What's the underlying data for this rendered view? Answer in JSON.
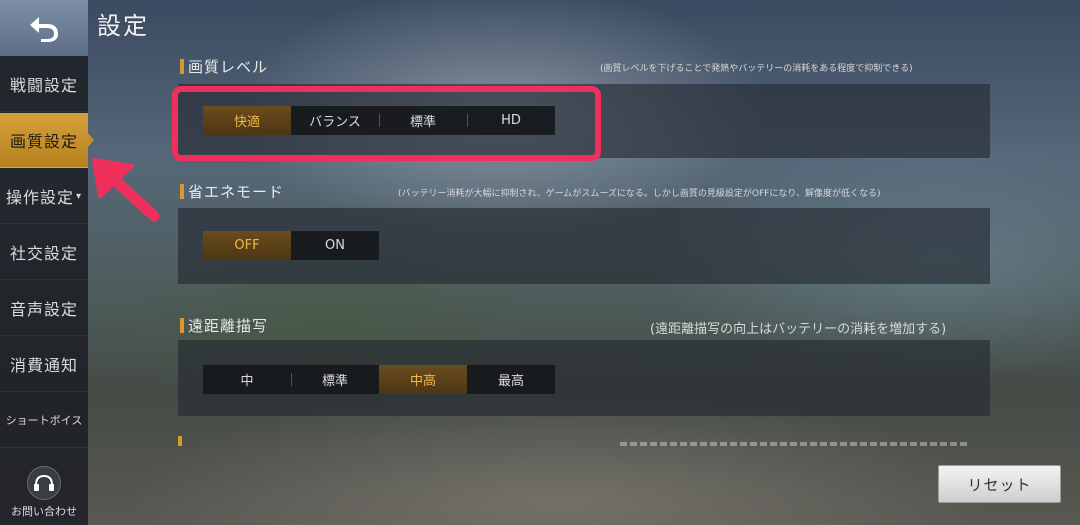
{
  "page_title": "設定",
  "sidebar": {
    "items": [
      {
        "label": "戦闘設定",
        "active": false
      },
      {
        "label": "画質設定",
        "active": true
      },
      {
        "label": "操作設定",
        "active": false,
        "has_arrow": true
      },
      {
        "label": "社交設定",
        "active": false
      },
      {
        "label": "音声設定",
        "active": false
      },
      {
        "label": "消費通知",
        "active": false
      },
      {
        "label": "ショートボイス",
        "active": false
      }
    ],
    "help_label": "お問い合わせ"
  },
  "sections": {
    "quality": {
      "title": "画質レベル",
      "note": "(画質レベルを下げることで発熱やバッテリーの消耗をある程度で抑制できる)",
      "options": [
        "快適",
        "バランス",
        "標準",
        "HD"
      ],
      "selected": "快適"
    },
    "power_saving": {
      "title": "省エネモード",
      "note": "(バッテリー消耗が大幅に抑制され、ゲームがスムーズになる。しかし画質の見級設定がOFFになり、解像度が低くなる)",
      "options": [
        "OFF",
        "ON"
      ],
      "selected": "OFF"
    },
    "draw_distance": {
      "title": "遠距離描写",
      "note": "(遠距離描写の向上はバッテリーの消耗を増加する)",
      "options": [
        "中",
        "標準",
        "中高",
        "最高"
      ],
      "selected": "中高"
    }
  },
  "reset_label": "リセット",
  "colors": {
    "accent": "#d89b2b",
    "annotation": "#f0305c",
    "sidebar_active": "#c38f2b"
  }
}
